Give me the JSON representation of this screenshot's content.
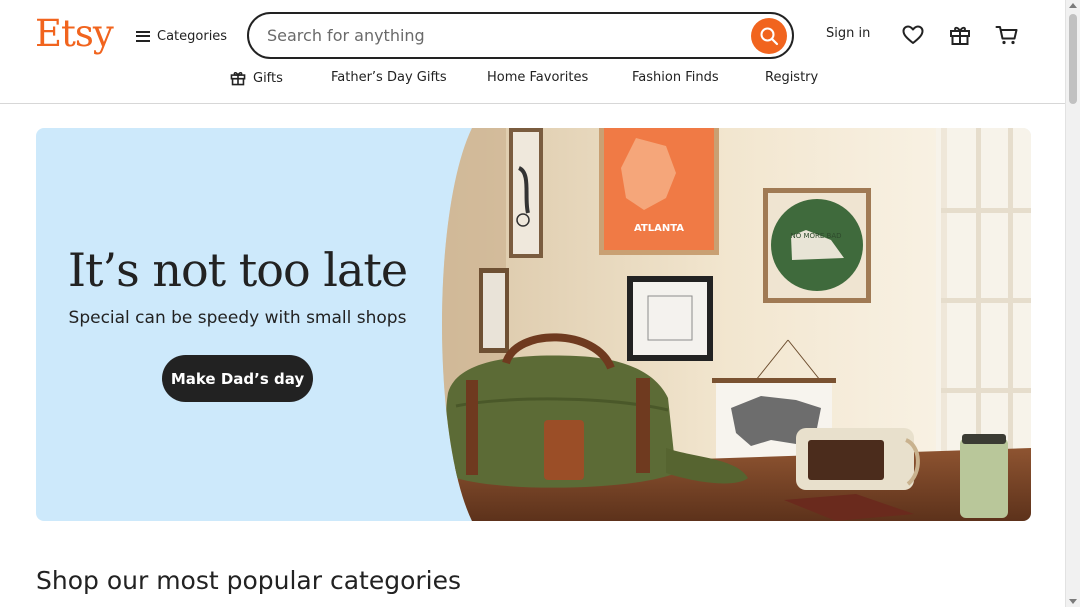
{
  "brand": {
    "logo_text": "Etsy",
    "accent": "#f1641e"
  },
  "header": {
    "categories_label": "Categories",
    "search": {
      "placeholder": "Search for anything",
      "value": ""
    },
    "signin_label": "Sign in",
    "icons": [
      "favorites-icon",
      "gift-icon",
      "cart-icon"
    ]
  },
  "subnav": {
    "items": [
      {
        "label": "Gifts",
        "icon": "gift-icon"
      },
      {
        "label": "Father’s Day Gifts"
      },
      {
        "label": "Home Favorites"
      },
      {
        "label": "Fashion Finds"
      },
      {
        "label": "Registry"
      }
    ]
  },
  "hero": {
    "title": "It’s not too late",
    "subtitle": "Special can be speedy with small shops",
    "cta_label": "Make Dad’s day",
    "image": {
      "poster_text": "ATLANTA",
      "sign_text": "NO MORE BAD",
      "background": "#cde9fb"
    }
  },
  "section": {
    "title": "Shop our most popular categories"
  }
}
